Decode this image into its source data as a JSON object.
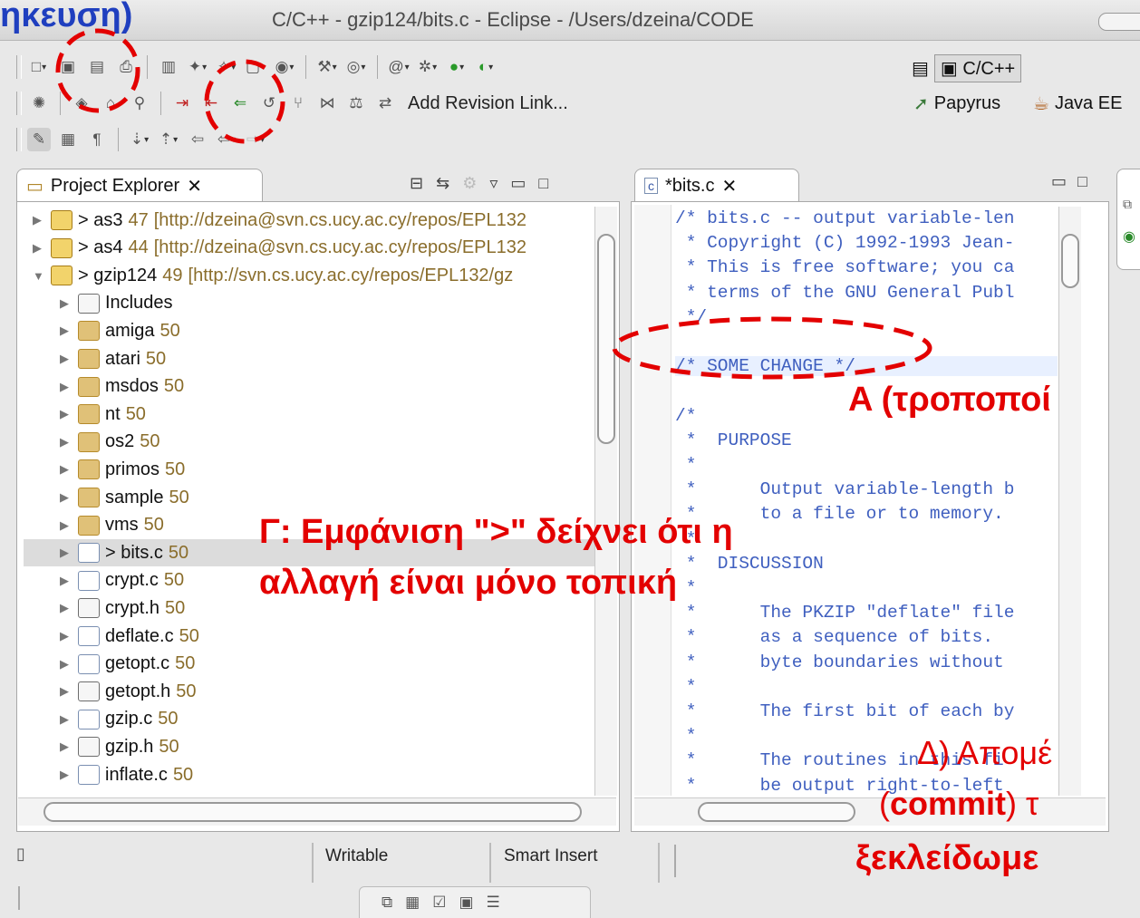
{
  "window": {
    "title": "C/C++ - gzip124/bits.c - Eclipse - /Users/dzeina/CODE",
    "overlay_title_fragment": "ηκευση)"
  },
  "toolbar": {
    "add_revision_link": "Add Revision Link...",
    "perspectives": {
      "cpp": "C/C++",
      "papyrus": "Papyrus",
      "javaee": "Java EE"
    }
  },
  "project_explorer": {
    "tab_label": "Project Explorer",
    "items": [
      {
        "prefix": "> ",
        "name": "as3",
        "rev": "47",
        "url": "[http://dzeina@svn.cs.ucy.ac.cy/repos/EPL132",
        "expanded": false,
        "kind": "proj",
        "indent": 0
      },
      {
        "prefix": "> ",
        "name": "as4",
        "rev": "44",
        "url": "[http://dzeina@svn.cs.ucy.ac.cy/repos/EPL132",
        "expanded": false,
        "kind": "proj",
        "indent": 0
      },
      {
        "prefix": "> ",
        "name": "gzip124",
        "rev": "49",
        "url": "[http://svn.cs.ucy.ac.cy/repos/EPL132/gz",
        "expanded": true,
        "kind": "proj",
        "indent": 0
      },
      {
        "prefix": "",
        "name": "Includes",
        "rev": "",
        "url": "",
        "kind": "inc",
        "indent": 1
      },
      {
        "prefix": "",
        "name": "amiga",
        "rev": "50",
        "url": "",
        "kind": "folder",
        "indent": 1
      },
      {
        "prefix": "",
        "name": "atari",
        "rev": "50",
        "url": "",
        "kind": "folder",
        "indent": 1
      },
      {
        "prefix": "",
        "name": "msdos",
        "rev": "50",
        "url": "",
        "kind": "folder",
        "indent": 1
      },
      {
        "prefix": "",
        "name": "nt",
        "rev": "50",
        "url": "",
        "kind": "folder",
        "indent": 1
      },
      {
        "prefix": "",
        "name": "os2",
        "rev": "50",
        "url": "",
        "kind": "folder",
        "indent": 1
      },
      {
        "prefix": "",
        "name": "primos",
        "rev": "50",
        "url": "",
        "kind": "folder",
        "indent": 1
      },
      {
        "prefix": "",
        "name": "sample",
        "rev": "50",
        "url": "",
        "kind": "folder",
        "indent": 1
      },
      {
        "prefix": "",
        "name": "vms",
        "rev": "50",
        "url": "",
        "kind": "folder",
        "indent": 1
      },
      {
        "prefix": "> ",
        "name": "bits.c",
        "rev": "50",
        "url": "",
        "kind": "cfile",
        "indent": 1,
        "selected": true
      },
      {
        "prefix": "",
        "name": "crypt.c",
        "rev": "50",
        "url": "",
        "kind": "cfile",
        "indent": 1
      },
      {
        "prefix": "",
        "name": "crypt.h",
        "rev": "50",
        "url": "",
        "kind": "hfile",
        "indent": 1
      },
      {
        "prefix": "",
        "name": "deflate.c",
        "rev": "50",
        "url": "",
        "kind": "cfile",
        "indent": 1
      },
      {
        "prefix": "",
        "name": "getopt.c",
        "rev": "50",
        "url": "",
        "kind": "cfile",
        "indent": 1
      },
      {
        "prefix": "",
        "name": "getopt.h",
        "rev": "50",
        "url": "",
        "kind": "hfile",
        "indent": 1
      },
      {
        "prefix": "",
        "name": "gzip.c",
        "rev": "50",
        "url": "",
        "kind": "cfile",
        "indent": 1
      },
      {
        "prefix": "",
        "name": "gzip.h",
        "rev": "50",
        "url": "",
        "kind": "hfile",
        "indent": 1
      },
      {
        "prefix": "",
        "name": "inflate.c",
        "rev": "50",
        "url": "",
        "kind": "cfile",
        "indent": 1
      }
    ]
  },
  "editor": {
    "tab_label": "*bits.c",
    "lines": [
      "/* bits.c -- output variable-len",
      " * Copyright (C) 1992-1993 Jean-",
      " * This is free software; you ca",
      " * terms of the GNU General Publ",
      " */",
      "",
      "/* SOME CHANGE */",
      "",
      "/*",
      " *  PURPOSE",
      " *",
      " *      Output variable-length b",
      " *      to a file or to memory.",
      " *",
      " *  DISCUSSION",
      " *",
      " *      The PKZIP \"deflate\" file",
      " *      as a sequence of bits.",
      " *      byte boundaries without",
      " *",
      " *      The first bit of each by",
      " *",
      " *      The routines in this fi",
      " *      be output right-to-left"
    ]
  },
  "statusbar": {
    "writable": "Writable",
    "insert_mode": "Smart Insert"
  },
  "annotations": {
    "a": "A (τροποποί",
    "g_line1": "Γ: Εμφάνιση \">\" δείχνει ότι η",
    "g_line2": "αλλαγή είναι μόνο τοπική",
    "d_line1": "Δ) Απομέ",
    "d_line2_bold": "commit",
    "d_line2_open": "(",
    "d_line2_rest": ") τ",
    "d_line3": "ξεκλείδωμε"
  },
  "colors": {
    "annotation_red": "#e30000",
    "comment_blue": "#3f5fbf",
    "svn_decoration": "#8a6d2b"
  }
}
